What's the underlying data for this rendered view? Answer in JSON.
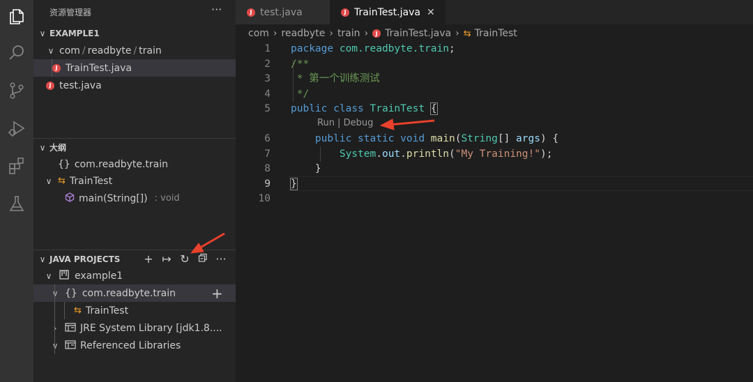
{
  "activity_bar": {
    "items": [
      {
        "name": "files-icon"
      },
      {
        "name": "search-icon"
      },
      {
        "name": "source-control-icon"
      },
      {
        "name": "run-debug-icon"
      },
      {
        "name": "extensions-icon"
      },
      {
        "name": "testing-icon"
      }
    ]
  },
  "explorer": {
    "title": "资源管理器",
    "more": "···",
    "workspace": "EXAMPLE1",
    "folder": [
      "com",
      "readbyte",
      "train"
    ],
    "files": [
      "TrainTest.java",
      "test.java"
    ]
  },
  "outline": {
    "title": "大纲",
    "items": [
      {
        "icon": "{}",
        "label": "com.readbyte.train"
      },
      {
        "label": "TrainTest"
      },
      {
        "label": "main(String[])",
        "detail": ": void"
      }
    ]
  },
  "java_projects": {
    "title": "JAVA PROJECTS",
    "project": "example1",
    "package": "com.readbyte.train",
    "class": "TrainTest",
    "jre": "JRE System Library [jdk1.8....",
    "referenced": "Referenced Libraries"
  },
  "editor": {
    "tabs": [
      {
        "label": "test.java",
        "active": false
      },
      {
        "label": "TrainTest.java",
        "active": true,
        "close": "✕"
      }
    ],
    "breadcrumbs": [
      "com",
      "readbyte",
      "train",
      "TrainTest.java",
      "TrainTest"
    ],
    "codelens": "Run | Debug",
    "line_numbers": [
      "1",
      "2",
      "3",
      "4",
      "5",
      "6",
      "7",
      "8",
      "9",
      "10"
    ],
    "current_line": "9",
    "code": {
      "l1_kw": "package",
      "l1_pkg": "com.readbyte.train",
      "l2": "/**",
      "l3": " * 第一个训练测试",
      "l4": " */",
      "l5_kw1": "public",
      "l5_kw2": "class",
      "l5_name": "TrainTest",
      "l6_kw": "public static void",
      "l6_fn": "main",
      "l6_type": "String",
      "l6_arg": "args",
      "l7_sys": "System",
      "l7_out": "out",
      "l7_fn": "println",
      "l7_str": "\"My Training!\"",
      "l8": "}",
      "l9": "}"
    }
  },
  "colors": {
    "annotation_arrow": "#e8412c",
    "keyword": "#569cd6",
    "comment": "#6a9955",
    "type": "#4ec9b0",
    "function": "#dcdcaa",
    "string": "#ce9178",
    "java_badge": "#e04a4a"
  }
}
